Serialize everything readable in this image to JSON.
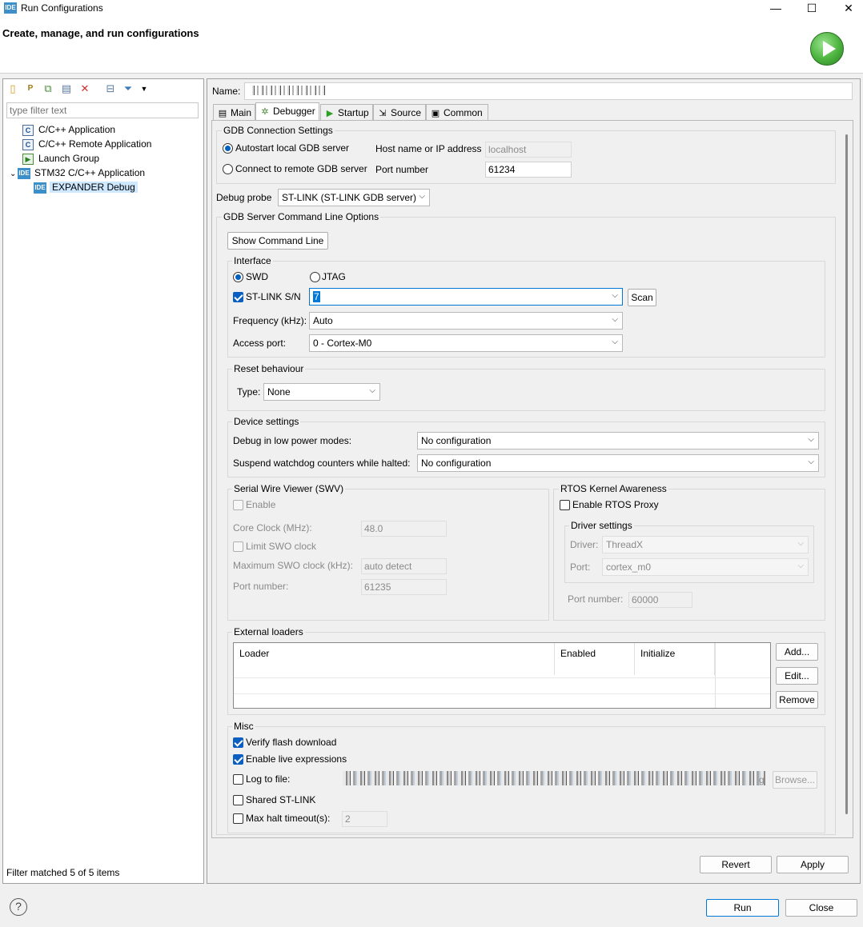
{
  "window": {
    "icon_text": "IDE",
    "title": "Run Configurations",
    "minimize": "—",
    "maximize": "☐",
    "close": "✕"
  },
  "banner": {
    "title": "Create, manage, and run configurations"
  },
  "left": {
    "toolbar_icons": [
      "new-config-icon",
      "new-prototype-icon",
      "duplicate-icon",
      "export-icon",
      "delete-icon",
      "collapse-all-icon",
      "filter-icon",
      "dropdown-icon"
    ],
    "filter_placeholder": "type filter text",
    "tree": [
      {
        "label": "C/C++ Application",
        "icon": "C"
      },
      {
        "label": "C/C++ Remote Application",
        "icon": "C"
      },
      {
        "label": "Launch Group",
        "icon": "launch-group"
      },
      {
        "label": "STM32 C/C++ Application",
        "icon": "IDE",
        "expanded": true
      },
      {
        "label": "EXPANDER Debug",
        "icon": "IDE",
        "selected": true
      }
    ],
    "status": "Filter matched 5 of 5 items"
  },
  "right": {
    "name_label": "Name:",
    "name_value": "",
    "tabs": [
      "Main",
      "Debugger",
      "Startup",
      "Source",
      "Common"
    ],
    "active_tab": "Debugger",
    "gdb": {
      "title": "GDB Connection Settings",
      "autostart": "Autostart local GDB server",
      "connect_remote": "Connect to remote GDB server",
      "host_label": "Host name or IP address",
      "host_value": "localhost",
      "port_label": "Port number",
      "port_value": "61234"
    },
    "probe": {
      "label": "Debug probe",
      "value": "ST-LINK (ST-LINK GDB server)"
    },
    "server": {
      "title": "GDB Server Command Line Options",
      "show_cmd": "Show Command Line"
    },
    "interface": {
      "title": "Interface",
      "swd": "SWD",
      "jtag": "JTAG",
      "sn_label": "ST-LINK S/N",
      "sn_value": "7",
      "scan": "Scan",
      "freq_label": "Frequency (kHz):",
      "freq_value": "Auto",
      "port_label": "Access port:",
      "port_value": "0 - Cortex-M0"
    },
    "reset": {
      "title": "Reset behaviour",
      "type_label": "Type:",
      "type_value": "None"
    },
    "device": {
      "title": "Device settings",
      "low_power_label": "Debug in low power modes:",
      "low_power_value": "No configuration",
      "watchdog_label": "Suspend watchdog counters while halted:",
      "watchdog_value": "No configuration"
    },
    "swv": {
      "title": "Serial Wire Viewer (SWV)",
      "enable": "Enable",
      "core_clock_label": "Core Clock (MHz):",
      "core_clock_value": "48.0",
      "limit_label": "Limit SWO clock",
      "max_label": "Maximum SWO clock (kHz):",
      "max_value": "auto detect",
      "port_label": "Port number:",
      "port_value": "61235"
    },
    "rtos": {
      "title": "RTOS Kernel Awareness",
      "enable": "Enable RTOS Proxy",
      "driver_title": "Driver settings",
      "driver_label": "Driver:",
      "driver_value": "ThreadX",
      "port_label": "Port:",
      "port_value": "cortex_m0",
      "portnum_label": "Port number:",
      "portnum_value": "60000"
    },
    "loaders": {
      "title": "External loaders",
      "columns": [
        "Loader",
        "Enabled",
        "Initialize"
      ],
      "add": "Add...",
      "edit": "Edit...",
      "remove": "Remove"
    },
    "misc": {
      "title": "Misc",
      "verify": "Verify flash download",
      "live": "Enable live expressions",
      "log": "Log to file:",
      "log_suffix": "g",
      "browse": "Browse...",
      "shared": "Shared ST-LINK",
      "max_halt": "Max halt timeout(s):",
      "max_halt_value": "2"
    },
    "revert": "Revert",
    "apply": "Apply"
  },
  "footer": {
    "help": "?",
    "run": "Run",
    "close": "Close"
  },
  "colors": {
    "accent": "#0078d7",
    "selection": "#cde8ff",
    "run_green": "#4bb33d",
    "delete_red": "#d32f2f"
  }
}
